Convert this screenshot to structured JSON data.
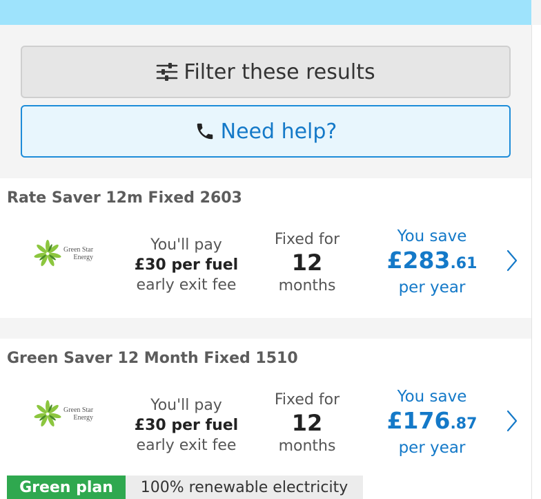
{
  "filter_button": {
    "label": "Filter these results",
    "icon": "sliders-icon"
  },
  "help_button": {
    "label": "Need help?",
    "icon": "phone-icon"
  },
  "results": [
    {
      "plan_name": "Rate Saver 12m Fixed 2603",
      "supplier": {
        "line1": "Green Star",
        "line2": "Energy"
      },
      "pay_label": "You'll pay",
      "exit_fee": "£30 per fuel",
      "exit_fee_label": "early exit fee",
      "fixed_label": "Fixed for",
      "fixed_months": "12",
      "months_label": "months",
      "save_label": "You save",
      "save_pounds": "£283",
      "save_pence": ".61",
      "save_period": "per year"
    },
    {
      "plan_name": "Green Saver 12 Month Fixed 1510",
      "supplier": {
        "line1": "Green Star",
        "line2": "Energy"
      },
      "pay_label": "You'll pay",
      "exit_fee": "£30 per fuel",
      "exit_fee_label": "early exit fee",
      "fixed_label": "Fixed for",
      "fixed_months": "12",
      "months_label": "months",
      "save_label": "You save",
      "save_pounds": "£176",
      "save_pence": ".87",
      "save_period": "per year",
      "badge": "Green plan",
      "badge_desc": "100% renewable electricity"
    }
  ],
  "colors": {
    "accent_blue": "#1479c8",
    "header_blue": "#9ee3fc",
    "green": "#2fa84f",
    "logo_green": "#8cc63f"
  }
}
